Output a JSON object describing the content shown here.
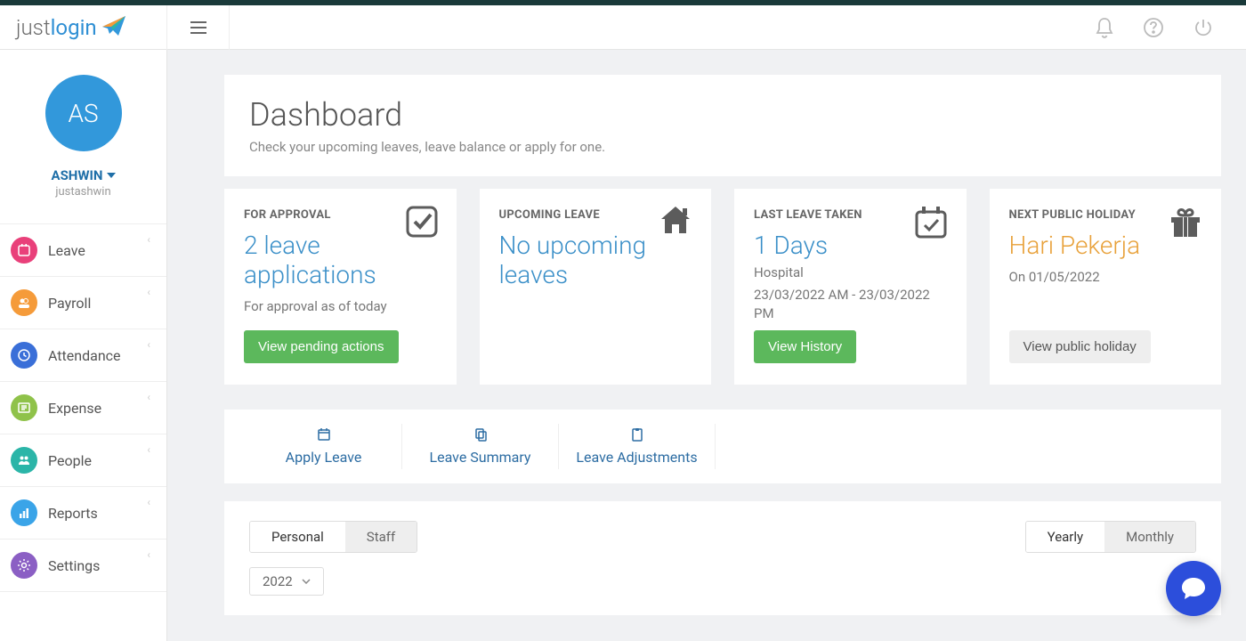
{
  "brand": {
    "part1": "just",
    "part2": "login"
  },
  "user": {
    "initials": "AS",
    "name": "ASHWIN",
    "handle": "justashwin"
  },
  "sidebar": {
    "items": [
      {
        "label": "Leave",
        "color": "#e9407a"
      },
      {
        "label": "Payroll",
        "color": "#f59b3a"
      },
      {
        "label": "Attendance",
        "color": "#3a6fd8"
      },
      {
        "label": "Expense",
        "color": "#8fc24a"
      },
      {
        "label": "People",
        "color": "#2bb5a8"
      },
      {
        "label": "Reports",
        "color": "#3aa4e8"
      },
      {
        "label": "Settings",
        "color": "#8b5fc4"
      }
    ]
  },
  "header": {
    "title": "Dashboard",
    "subtitle": "Check your upcoming leaves, leave balance or apply for one."
  },
  "cards": {
    "approval": {
      "label": "FOR APPROVAL",
      "big": "2 leave applications",
      "sub": "For approval as of today",
      "button": "View pending actions"
    },
    "upcoming": {
      "label": "UPCOMING LEAVE",
      "big": "No upcoming leaves"
    },
    "last": {
      "label": "LAST LEAVE TAKEN",
      "big": "1 Days",
      "type": "Hospital",
      "period": "23/03/2022 AM - 23/03/2022 PM",
      "button": "View History"
    },
    "holiday": {
      "label": "NEXT PUBLIC HOLIDAY",
      "big": "Hari Pekerja",
      "date": "On 01/05/2022",
      "button": "View public holiday"
    }
  },
  "actions": [
    {
      "label": "Apply Leave"
    },
    {
      "label": "Leave Summary"
    },
    {
      "label": "Leave Adjustments"
    }
  ],
  "tabs": {
    "left": [
      {
        "label": "Personal",
        "active": true
      },
      {
        "label": "Staff",
        "active": false
      }
    ],
    "right": [
      {
        "label": "Yearly",
        "active": true
      },
      {
        "label": "Monthly",
        "active": false
      }
    ],
    "year": "2022"
  }
}
